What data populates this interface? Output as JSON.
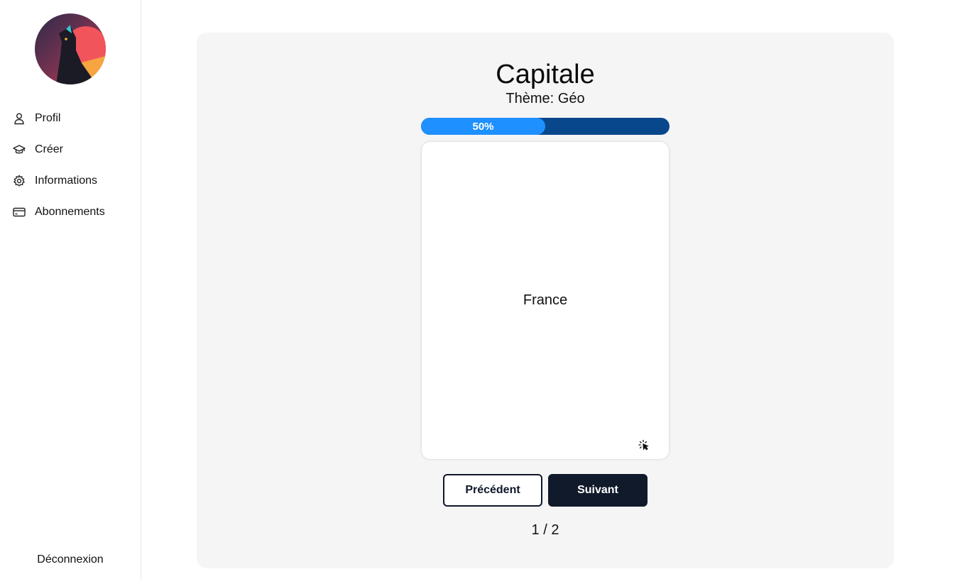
{
  "sidebar": {
    "items": [
      {
        "label": "Profil",
        "icon": "user-icon"
      },
      {
        "label": "Créer",
        "icon": "graduation-cap-icon"
      },
      {
        "label": "Informations",
        "icon": "gear-icon"
      },
      {
        "label": "Abonnements",
        "icon": "credit-card-icon"
      }
    ],
    "logout_label": "Déconnexion"
  },
  "deck": {
    "title": "Capitale",
    "theme": "Thème: Géo",
    "progress_text": "50%",
    "progress_fraction": 0.5,
    "card_text": "France",
    "prev_label": "Précédent",
    "next_label": "Suivant",
    "counter": "1 / 2"
  },
  "colors": {
    "progress_fill": "#1e90ff",
    "progress_track": "#08478c",
    "primary_button": "#111a2b"
  }
}
